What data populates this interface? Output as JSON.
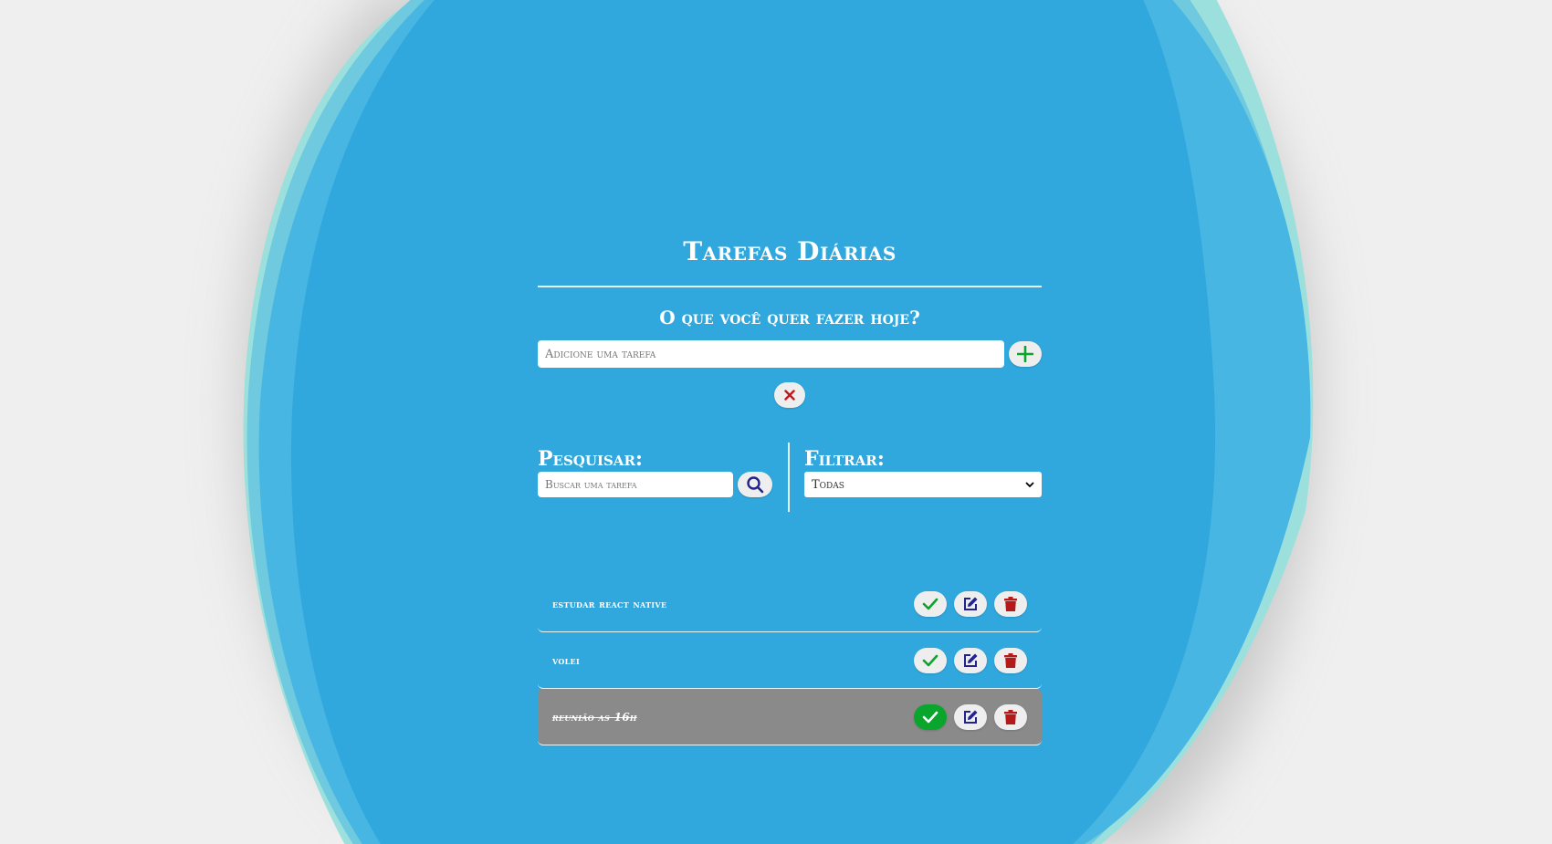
{
  "header": {
    "title": "Tarefas Diárias",
    "subtitle": "O que você quer fazer hoje?"
  },
  "add_form": {
    "placeholder": "Adicione uma tarefa",
    "add_icon": "plus-icon",
    "cancel_icon": "close-icon"
  },
  "search": {
    "label": "Pesquisar:",
    "placeholder": "Buscar uma tarefa",
    "icon": "search-icon"
  },
  "filter": {
    "label": "Filtrar:",
    "selected": "Todas"
  },
  "todos": [
    {
      "text": "estudar react native",
      "done": false
    },
    {
      "text": "volei",
      "done": false
    },
    {
      "text": "reunião as 16h",
      "done": true
    }
  ],
  "colors": {
    "background": "#efefef",
    "blob": "#30a8de",
    "blob_light": "#73cce0",
    "done_row": "#8a8a8a",
    "finish_green": "#0aa52c",
    "edit_blue": "#23238e",
    "delete_red": "#b51a1a",
    "close_red": "#c0181c"
  }
}
